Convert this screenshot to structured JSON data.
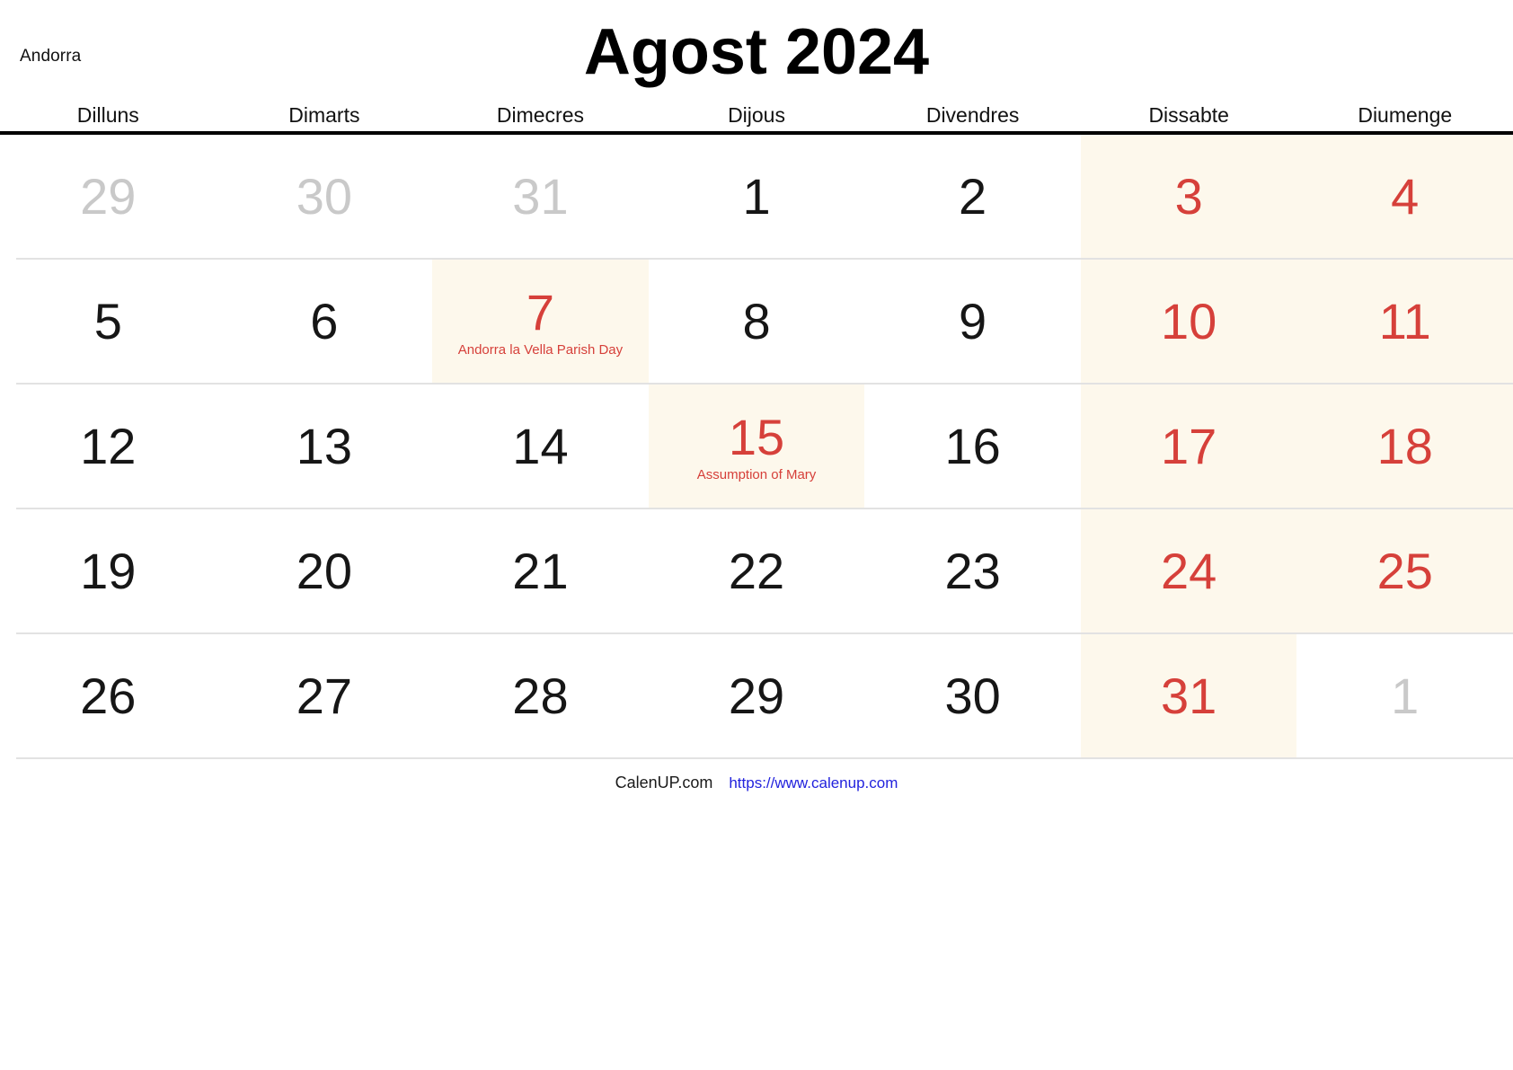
{
  "header": {
    "region": "Andorra",
    "title": "Agost 2024"
  },
  "weekdays": [
    {
      "label": "Dilluns"
    },
    {
      "label": "Dimarts"
    },
    {
      "label": "Dimecres"
    },
    {
      "label": "Dijous"
    },
    {
      "label": "Divendres"
    },
    {
      "label": "Dissabte"
    },
    {
      "label": "Diumenge"
    }
  ],
  "colors": {
    "weekend_bg": "#fdf8ec",
    "holiday_bg": "#fdf8ec",
    "red": "#d6403a",
    "gray_out_of_month": "#c9c9c9",
    "link": "#2222dd",
    "divider": "#e2e2e2",
    "header_rule": "#000000"
  },
  "weeks": [
    {
      "days": [
        {
          "num": "29",
          "out_of_month": true,
          "red": false,
          "shaded": false,
          "event": ""
        },
        {
          "num": "30",
          "out_of_month": true,
          "red": false,
          "shaded": false,
          "event": ""
        },
        {
          "num": "31",
          "out_of_month": true,
          "red": false,
          "shaded": false,
          "event": ""
        },
        {
          "num": "1",
          "out_of_month": false,
          "red": false,
          "shaded": false,
          "event": ""
        },
        {
          "num": "2",
          "out_of_month": false,
          "red": false,
          "shaded": false,
          "event": ""
        },
        {
          "num": "3",
          "out_of_month": false,
          "red": true,
          "shaded": true,
          "event": ""
        },
        {
          "num": "4",
          "out_of_month": false,
          "red": true,
          "shaded": true,
          "event": ""
        }
      ]
    },
    {
      "days": [
        {
          "num": "5",
          "out_of_month": false,
          "red": false,
          "shaded": false,
          "event": ""
        },
        {
          "num": "6",
          "out_of_month": false,
          "red": false,
          "shaded": false,
          "event": ""
        },
        {
          "num": "7",
          "out_of_month": false,
          "red": true,
          "shaded": true,
          "event": "Andorra la Vella Parish Day"
        },
        {
          "num": "8",
          "out_of_month": false,
          "red": false,
          "shaded": false,
          "event": ""
        },
        {
          "num": "9",
          "out_of_month": false,
          "red": false,
          "shaded": false,
          "event": ""
        },
        {
          "num": "10",
          "out_of_month": false,
          "red": true,
          "shaded": true,
          "event": ""
        },
        {
          "num": "11",
          "out_of_month": false,
          "red": true,
          "shaded": true,
          "event": ""
        }
      ]
    },
    {
      "days": [
        {
          "num": "12",
          "out_of_month": false,
          "red": false,
          "shaded": false,
          "event": ""
        },
        {
          "num": "13",
          "out_of_month": false,
          "red": false,
          "shaded": false,
          "event": ""
        },
        {
          "num": "14",
          "out_of_month": false,
          "red": false,
          "shaded": false,
          "event": ""
        },
        {
          "num": "15",
          "out_of_month": false,
          "red": true,
          "shaded": true,
          "event": "Assumption of Mary"
        },
        {
          "num": "16",
          "out_of_month": false,
          "red": false,
          "shaded": false,
          "event": ""
        },
        {
          "num": "17",
          "out_of_month": false,
          "red": true,
          "shaded": true,
          "event": ""
        },
        {
          "num": "18",
          "out_of_month": false,
          "red": true,
          "shaded": true,
          "event": ""
        }
      ]
    },
    {
      "days": [
        {
          "num": "19",
          "out_of_month": false,
          "red": false,
          "shaded": false,
          "event": ""
        },
        {
          "num": "20",
          "out_of_month": false,
          "red": false,
          "shaded": false,
          "event": ""
        },
        {
          "num": "21",
          "out_of_month": false,
          "red": false,
          "shaded": false,
          "event": ""
        },
        {
          "num": "22",
          "out_of_month": false,
          "red": false,
          "shaded": false,
          "event": ""
        },
        {
          "num": "23",
          "out_of_month": false,
          "red": false,
          "shaded": false,
          "event": ""
        },
        {
          "num": "24",
          "out_of_month": false,
          "red": true,
          "shaded": true,
          "event": ""
        },
        {
          "num": "25",
          "out_of_month": false,
          "red": true,
          "shaded": true,
          "event": ""
        }
      ]
    },
    {
      "days": [
        {
          "num": "26",
          "out_of_month": false,
          "red": false,
          "shaded": false,
          "event": ""
        },
        {
          "num": "27",
          "out_of_month": false,
          "red": false,
          "shaded": false,
          "event": ""
        },
        {
          "num": "28",
          "out_of_month": false,
          "red": false,
          "shaded": false,
          "event": ""
        },
        {
          "num": "29",
          "out_of_month": false,
          "red": false,
          "shaded": false,
          "event": ""
        },
        {
          "num": "30",
          "out_of_month": false,
          "red": false,
          "shaded": false,
          "event": ""
        },
        {
          "num": "31",
          "out_of_month": false,
          "red": true,
          "shaded": true,
          "event": ""
        },
        {
          "num": "1",
          "out_of_month": true,
          "red": false,
          "shaded": false,
          "event": ""
        }
      ]
    }
  ],
  "footer": {
    "brand": "CalenUP.com",
    "url": "https://www.calenup.com"
  }
}
